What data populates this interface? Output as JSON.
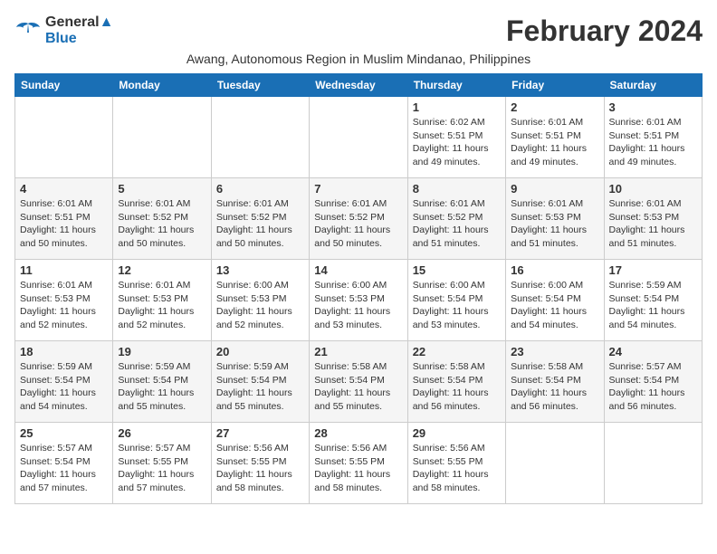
{
  "logo": {
    "line1": "General",
    "line2": "Blue"
  },
  "title": "February 2024",
  "location": "Awang, Autonomous Region in Muslim Mindanao, Philippines",
  "weekdays": [
    "Sunday",
    "Monday",
    "Tuesday",
    "Wednesday",
    "Thursday",
    "Friday",
    "Saturday"
  ],
  "weeks": [
    [
      {
        "day": "",
        "detail": ""
      },
      {
        "day": "",
        "detail": ""
      },
      {
        "day": "",
        "detail": ""
      },
      {
        "day": "",
        "detail": ""
      },
      {
        "day": "1",
        "detail": "Sunrise: 6:02 AM\nSunset: 5:51 PM\nDaylight: 11 hours\nand 49 minutes."
      },
      {
        "day": "2",
        "detail": "Sunrise: 6:01 AM\nSunset: 5:51 PM\nDaylight: 11 hours\nand 49 minutes."
      },
      {
        "day": "3",
        "detail": "Sunrise: 6:01 AM\nSunset: 5:51 PM\nDaylight: 11 hours\nand 49 minutes."
      }
    ],
    [
      {
        "day": "4",
        "detail": "Sunrise: 6:01 AM\nSunset: 5:51 PM\nDaylight: 11 hours\nand 50 minutes."
      },
      {
        "day": "5",
        "detail": "Sunrise: 6:01 AM\nSunset: 5:52 PM\nDaylight: 11 hours\nand 50 minutes."
      },
      {
        "day": "6",
        "detail": "Sunrise: 6:01 AM\nSunset: 5:52 PM\nDaylight: 11 hours\nand 50 minutes."
      },
      {
        "day": "7",
        "detail": "Sunrise: 6:01 AM\nSunset: 5:52 PM\nDaylight: 11 hours\nand 50 minutes."
      },
      {
        "day": "8",
        "detail": "Sunrise: 6:01 AM\nSunset: 5:52 PM\nDaylight: 11 hours\nand 51 minutes."
      },
      {
        "day": "9",
        "detail": "Sunrise: 6:01 AM\nSunset: 5:53 PM\nDaylight: 11 hours\nand 51 minutes."
      },
      {
        "day": "10",
        "detail": "Sunrise: 6:01 AM\nSunset: 5:53 PM\nDaylight: 11 hours\nand 51 minutes."
      }
    ],
    [
      {
        "day": "11",
        "detail": "Sunrise: 6:01 AM\nSunset: 5:53 PM\nDaylight: 11 hours\nand 52 minutes."
      },
      {
        "day": "12",
        "detail": "Sunrise: 6:01 AM\nSunset: 5:53 PM\nDaylight: 11 hours\nand 52 minutes."
      },
      {
        "day": "13",
        "detail": "Sunrise: 6:00 AM\nSunset: 5:53 PM\nDaylight: 11 hours\nand 52 minutes."
      },
      {
        "day": "14",
        "detail": "Sunrise: 6:00 AM\nSunset: 5:53 PM\nDaylight: 11 hours\nand 53 minutes."
      },
      {
        "day": "15",
        "detail": "Sunrise: 6:00 AM\nSunset: 5:54 PM\nDaylight: 11 hours\nand 53 minutes."
      },
      {
        "day": "16",
        "detail": "Sunrise: 6:00 AM\nSunset: 5:54 PM\nDaylight: 11 hours\nand 54 minutes."
      },
      {
        "day": "17",
        "detail": "Sunrise: 5:59 AM\nSunset: 5:54 PM\nDaylight: 11 hours\nand 54 minutes."
      }
    ],
    [
      {
        "day": "18",
        "detail": "Sunrise: 5:59 AM\nSunset: 5:54 PM\nDaylight: 11 hours\nand 54 minutes."
      },
      {
        "day": "19",
        "detail": "Sunrise: 5:59 AM\nSunset: 5:54 PM\nDaylight: 11 hours\nand 55 minutes."
      },
      {
        "day": "20",
        "detail": "Sunrise: 5:59 AM\nSunset: 5:54 PM\nDaylight: 11 hours\nand 55 minutes."
      },
      {
        "day": "21",
        "detail": "Sunrise: 5:58 AM\nSunset: 5:54 PM\nDaylight: 11 hours\nand 55 minutes."
      },
      {
        "day": "22",
        "detail": "Sunrise: 5:58 AM\nSunset: 5:54 PM\nDaylight: 11 hours\nand 56 minutes."
      },
      {
        "day": "23",
        "detail": "Sunrise: 5:58 AM\nSunset: 5:54 PM\nDaylight: 11 hours\nand 56 minutes."
      },
      {
        "day": "24",
        "detail": "Sunrise: 5:57 AM\nSunset: 5:54 PM\nDaylight: 11 hours\nand 56 minutes."
      }
    ],
    [
      {
        "day": "25",
        "detail": "Sunrise: 5:57 AM\nSunset: 5:54 PM\nDaylight: 11 hours\nand 57 minutes."
      },
      {
        "day": "26",
        "detail": "Sunrise: 5:57 AM\nSunset: 5:55 PM\nDaylight: 11 hours\nand 57 minutes."
      },
      {
        "day": "27",
        "detail": "Sunrise: 5:56 AM\nSunset: 5:55 PM\nDaylight: 11 hours\nand 58 minutes."
      },
      {
        "day": "28",
        "detail": "Sunrise: 5:56 AM\nSunset: 5:55 PM\nDaylight: 11 hours\nand 58 minutes."
      },
      {
        "day": "29",
        "detail": "Sunrise: 5:56 AM\nSunset: 5:55 PM\nDaylight: 11 hours\nand 58 minutes."
      },
      {
        "day": "",
        "detail": ""
      },
      {
        "day": "",
        "detail": ""
      }
    ]
  ]
}
